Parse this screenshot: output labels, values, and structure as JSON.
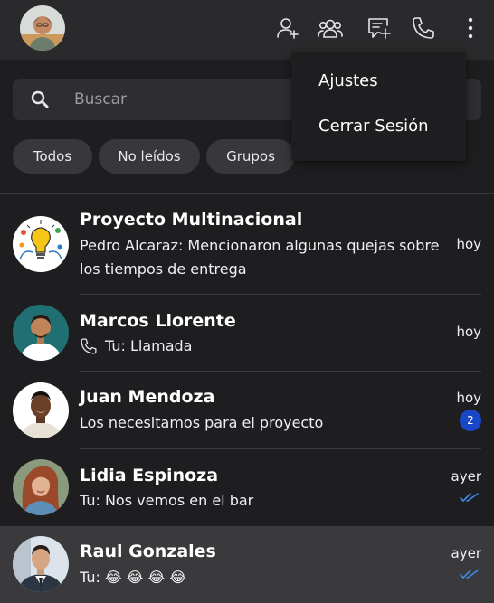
{
  "header": {
    "icons": [
      "add-contact-icon",
      "new-group-icon",
      "new-chat-icon",
      "call-icon",
      "more-options-icon"
    ]
  },
  "search": {
    "placeholder": "Buscar"
  },
  "filters": [
    {
      "label": "Todos"
    },
    {
      "label": "No leídos"
    },
    {
      "label": "Grupos"
    }
  ],
  "menu": {
    "items": [
      {
        "label": "Ajustes"
      },
      {
        "label": "Cerrar Sesión"
      }
    ]
  },
  "chats": [
    {
      "name": "Proyecto Multinacional",
      "preview": "Pedro Alcaraz: Mencionaron algunas quejas sobre los tiempos de entrega",
      "time": "hoy"
    },
    {
      "name": "Marcos Llorente",
      "preview": "Tu: Llamada",
      "time": "hoy"
    },
    {
      "name": "Juan Mendoza",
      "preview": "Los necesitamos para el proyecto",
      "time": "hoy",
      "unread": "2"
    },
    {
      "name": "Lidia Espinoza",
      "preview": "Tu: Nos vemos en el bar",
      "time": "ayer"
    },
    {
      "name": "Raul Gonzales",
      "preview": "Tu: 😂 😂 😂 😂",
      "time": "ayer"
    }
  ],
  "colors": {
    "accent": "#1848c8",
    "read_ticks": "#3d8be8"
  }
}
